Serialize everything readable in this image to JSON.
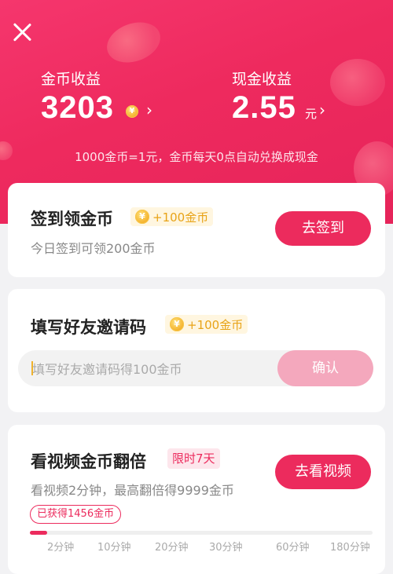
{
  "header": {
    "close_icon": "close-icon",
    "coin_label": "金币收益",
    "coin_value": "3203",
    "coin_symbol": "¥",
    "cash_label": "现金收益",
    "cash_value": "2.55",
    "cash_unit": "元",
    "chevron": "›",
    "rate_note": "1000金币=1元，金币每天0点自动兑换成现金",
    "accent": "#ec2b5d"
  },
  "checkin": {
    "title": "签到领金币",
    "reward": "+100金币",
    "desc": "今日签到可领200金币",
    "button": "去签到"
  },
  "invite": {
    "title": "填写好友邀请码",
    "reward": "+100金币",
    "placeholder": "填写好友邀请码得100金币",
    "value": "",
    "button": "确认"
  },
  "video": {
    "title": "看视频金币翻倍",
    "badge": "限时7天",
    "desc": "看视频2分钟，最高翻倍得9999金币",
    "button": "去看视频",
    "earned": "已获得1456金币",
    "progress_fraction": 0.05,
    "ticks": [
      "2分钟",
      "10分钟",
      "20分钟",
      "30分钟",
      "60分钟",
      "180分钟"
    ]
  }
}
